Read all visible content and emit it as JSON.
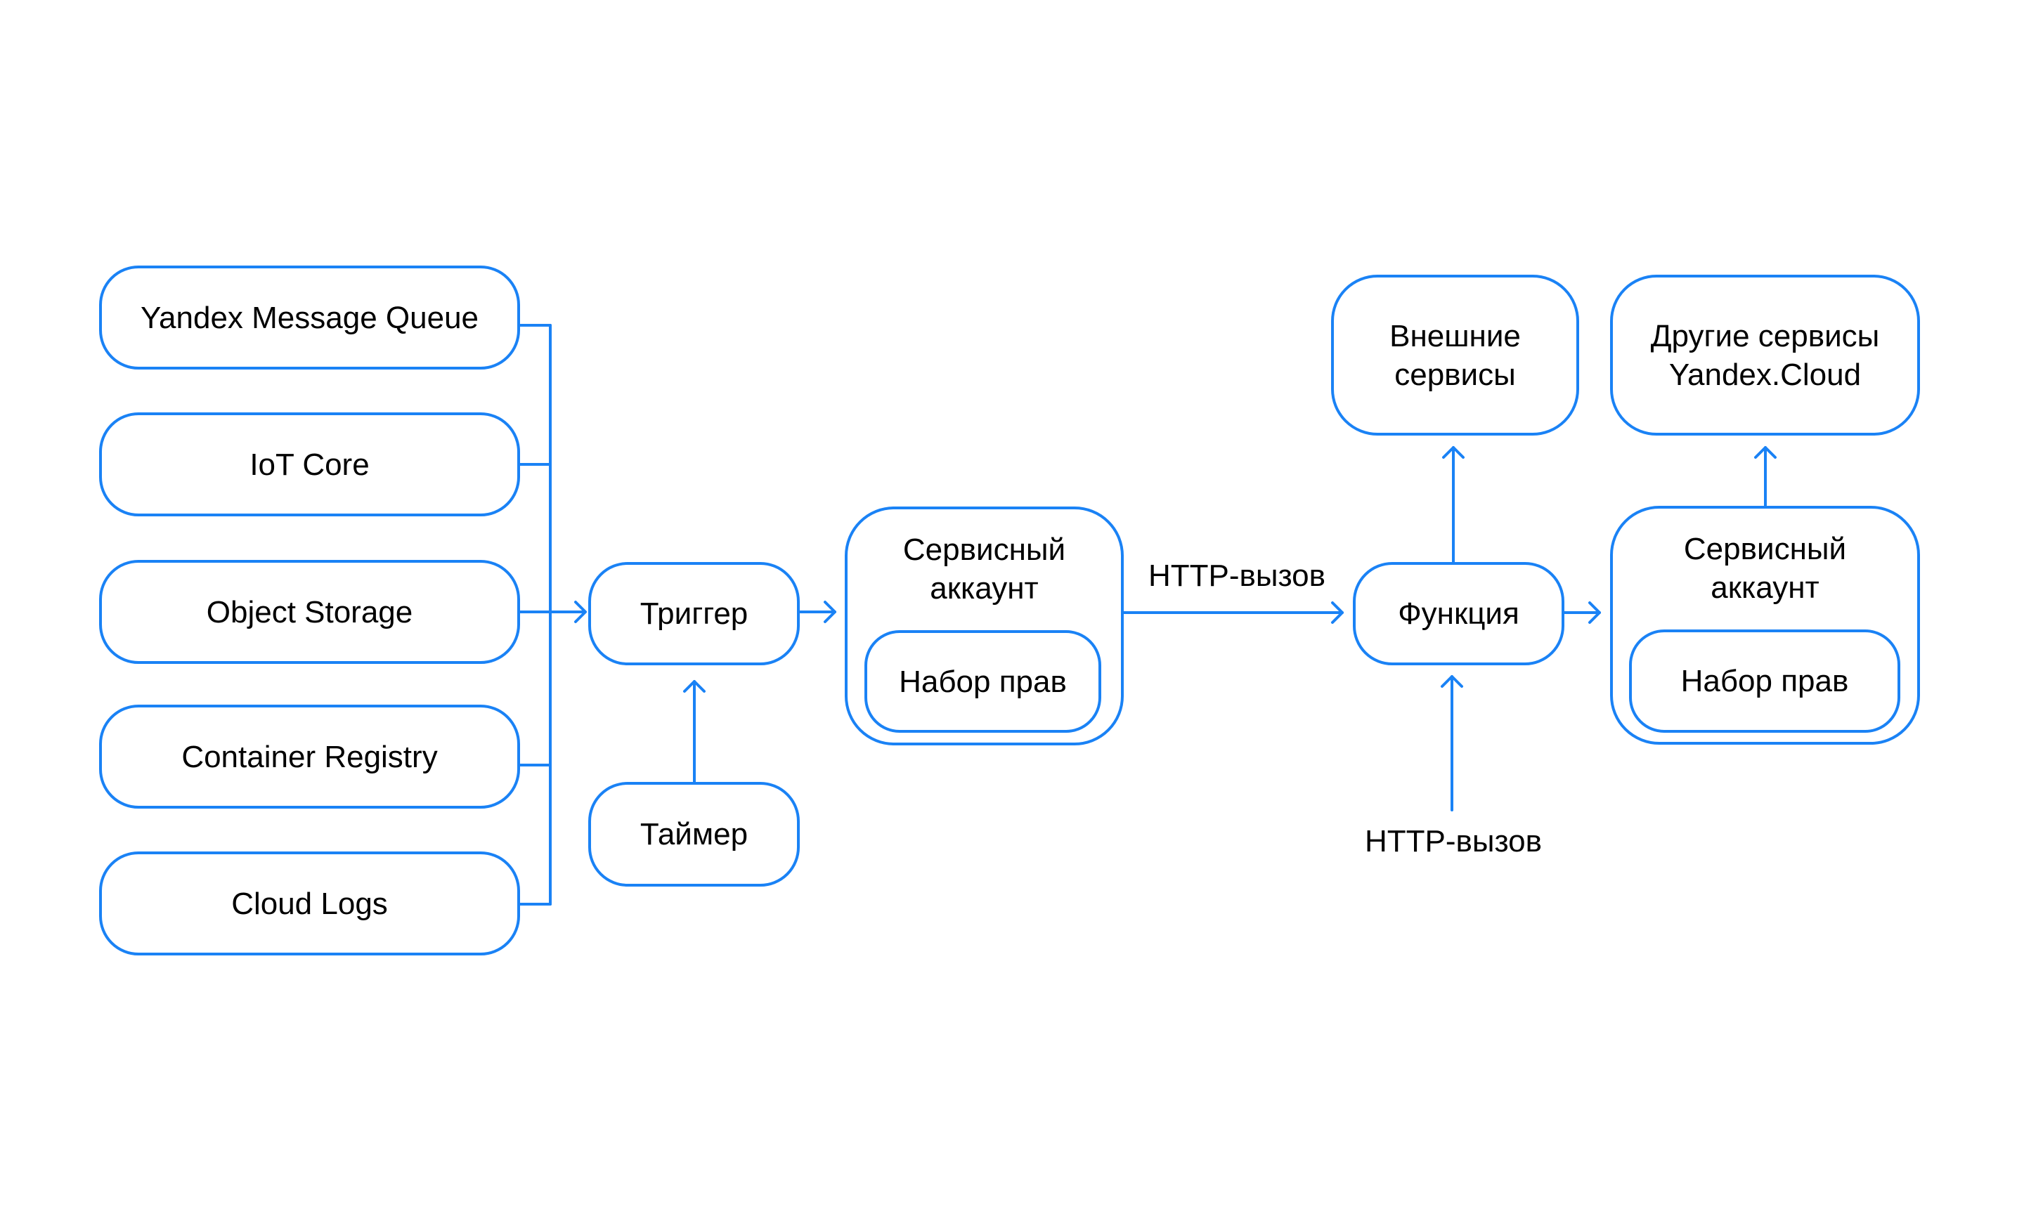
{
  "diagram": {
    "accent_color": "#1a82f5",
    "sources": [
      {
        "label": "Yandex Message Queue"
      },
      {
        "label": "IoT Core"
      },
      {
        "label": "Object Storage"
      },
      {
        "label": "Container Registry"
      },
      {
        "label": "Cloud Logs"
      }
    ],
    "trigger": {
      "label": "Триггер"
    },
    "timer": {
      "label": "Таймер"
    },
    "service_account_1": {
      "label": "Сервисный\nаккаунт",
      "permissions": "Набор прав"
    },
    "http_call_top": "HTTP-вызов",
    "function": {
      "label": "Функция"
    },
    "http_call_bottom": "HTTP-вызов",
    "external_services": {
      "label": "Внешние\nсервисы"
    },
    "other_services": {
      "label": "Другие сервисы\nYandex.Cloud"
    },
    "service_account_2": {
      "label": "Сервисный\nаккаунт",
      "permissions": "Набор прав"
    }
  }
}
